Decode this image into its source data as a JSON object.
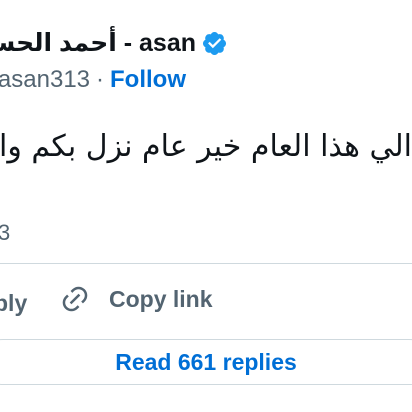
{
  "author": {
    "display_name": "أحمد الحسن - asan"
  },
  "handle_line": {
    "handle": "asan313",
    "separator": "·",
    "follow_label": "Follow"
  },
  "tweet": {
    "text": "الي هذا العام خير عام نزل بكم وار"
  },
  "timestamp": "3",
  "actions": {
    "reply_label": "ply",
    "copy_link_label": "Copy link"
  },
  "replies_button": {
    "label": "Read 661 replies"
  },
  "colors": {
    "text_primary": "#0f1419",
    "text_secondary": "#536471",
    "link_blue": "#006fd6",
    "verified_blue": "#1d9bf0",
    "border": "#cfd9de"
  },
  "icons": {
    "verified": "verified-badge-icon",
    "copy_link": "link-icon"
  }
}
